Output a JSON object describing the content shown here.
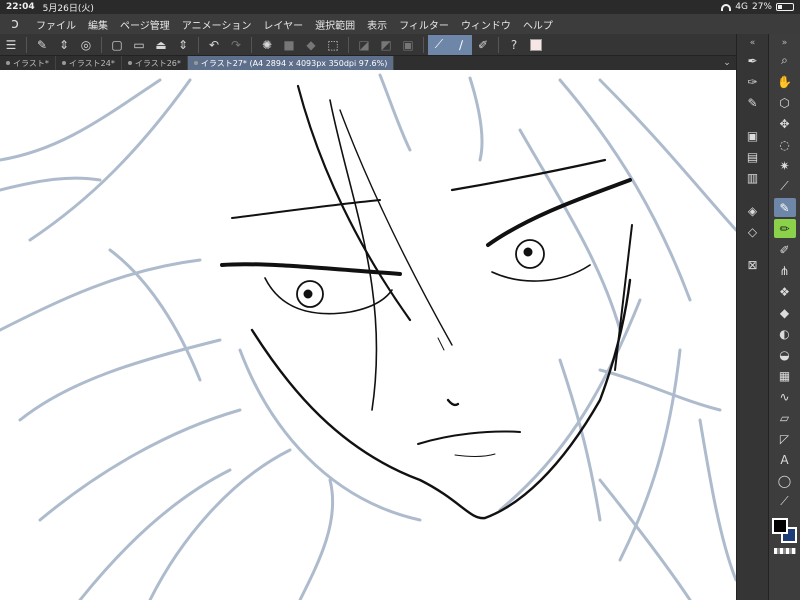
{
  "status": {
    "time": "22:04",
    "date": "5月26日(火)",
    "network": "4G",
    "battery": "27%",
    "battery_level": 0.27
  },
  "menu": [
    "ファイル",
    "編集",
    "ページ管理",
    "アニメーション",
    "レイヤー",
    "選択範囲",
    "表示",
    "フィルター",
    "ウィンドウ",
    "ヘルプ"
  ],
  "tabs": [
    {
      "label": "イラスト*"
    },
    {
      "label": "イラスト24*"
    },
    {
      "label": "イラスト26*"
    },
    {
      "label": "イラスト27* (A4 2894 x 4093px 350dpi 97.6%)"
    }
  ],
  "panel_top": {
    "collapse": "«",
    "expand": "»"
  },
  "colors": {
    "main": "#000000",
    "sub": "#1b3c78",
    "toolbar_swatch": "#f7e6e6",
    "accent": "#6e86a8",
    "active_tool": "#8bd14a",
    "sketch": "#9fb0c4"
  }
}
